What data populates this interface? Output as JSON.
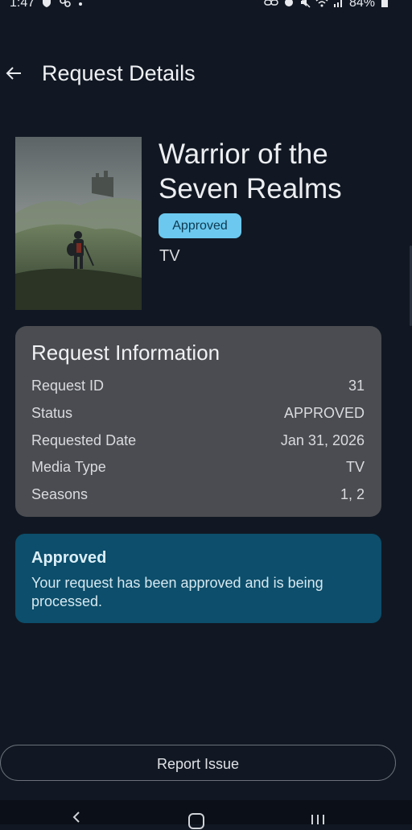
{
  "status_bar": {
    "time": "1:47",
    "battery": "84%"
  },
  "header": {
    "title": "Request Details"
  },
  "media": {
    "title": "Warrior of the Seven Realms",
    "status_badge": "Approved",
    "type": "TV"
  },
  "request_info": {
    "title": "Request Information",
    "rows": [
      {
        "label": "Request ID",
        "value": "31"
      },
      {
        "label": "Status",
        "value": "APPROVED"
      },
      {
        "label": "Requested Date",
        "value": "Jan 31, 2026"
      },
      {
        "label": "Media Type",
        "value": "TV"
      },
      {
        "label": "Seasons",
        "value": "1, 2"
      }
    ]
  },
  "approval": {
    "title": "Approved",
    "message": "Your request has been approved and is being processed."
  },
  "actions": {
    "report_label": "Report Issue"
  },
  "colors": {
    "background": "#111823",
    "card": "#4a4c51",
    "badge": "#6cc8ee",
    "approved_card": "#0c4e6b"
  }
}
